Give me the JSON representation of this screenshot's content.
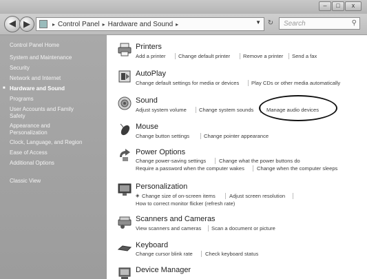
{
  "window": {
    "controls": {
      "minimize": "–",
      "maximize": "□",
      "close": "x"
    }
  },
  "nav": {
    "back_glyph": "◀",
    "forward_glyph": "▶",
    "breadcrumb": [
      "Control Panel",
      "Hardware and Sound"
    ],
    "separator": "▸",
    "refresh_glyph": "↻",
    "search_placeholder": "Search",
    "search_glyph": "⚲"
  },
  "sidebar": {
    "items": [
      "Control Panel Home",
      "System and Maintenance",
      "Security",
      "Network and Internet",
      "Hardware and Sound",
      "Programs",
      "User Accounts and Family",
      "Safety",
      "Appearance and",
      "Personalization",
      "Clock, Language, and Region",
      "Ease of Access",
      "Additional Options",
      "Classic View"
    ],
    "active_bullet": "■"
  },
  "categories": {
    "printers": {
      "title": "Printers",
      "links": [
        "Add a printer",
        "Change default printer",
        "Remove a printer",
        "Send a fax"
      ]
    },
    "autoplay": {
      "title": "AutoPlay",
      "links": [
        "Change default settings for media or devices",
        "Play CDs or other media automatically"
      ]
    },
    "sound": {
      "title": "Sound",
      "links": [
        "Adjust system volume",
        "Change system sounds",
        "Manage audio devices"
      ]
    },
    "mouse": {
      "title": "Mouse",
      "links": [
        "Change button settings",
        "Change pointer appearance"
      ]
    },
    "power": {
      "title": "Power Options",
      "links": [
        "Change power-saving settings",
        "Change what the power buttons do",
        "Require a password when the computer wakes",
        "Change when the computer sleeps"
      ]
    },
    "personalization": {
      "title": "Personalization",
      "links": [
        "Change size of on-screen items",
        "Adjust screen resolution",
        "How to correct monitor flicker (refresh rate)"
      ]
    },
    "scanners": {
      "title": "Scanners and Cameras",
      "links": [
        "View scanners and cameras",
        "Scan a document or picture"
      ]
    },
    "keyboard": {
      "title": "Keyboard",
      "links": [
        "Change cursor blink rate",
        "Check keyboard status"
      ]
    },
    "device_manager": {
      "title": "Device Manager"
    }
  },
  "colors": {
    "highlight_ring": "#111111"
  },
  "icons": [
    "printer-icon",
    "autoplay-icon",
    "sound-icon",
    "mouse-icon",
    "power-icon",
    "personalization-icon",
    "scanner-icon",
    "keyboard-icon",
    "device-manager-icon"
  ]
}
